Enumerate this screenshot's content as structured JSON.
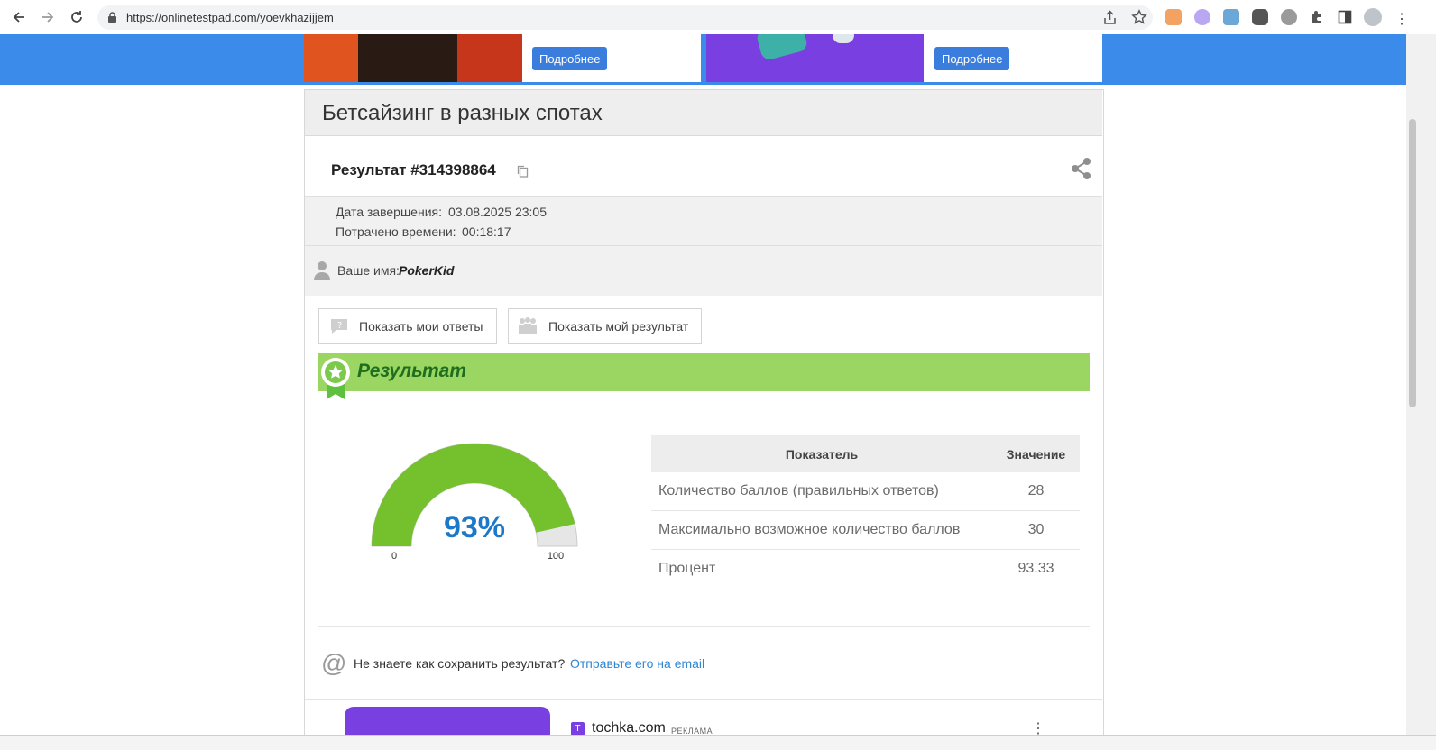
{
  "browser": {
    "url": "https://onlinetestpad.com/yoevkhazijjem"
  },
  "ads": {
    "more_label_1": "Подробнее",
    "more_label_2": "Подробнее"
  },
  "test": {
    "title": "Бетсайзинг в разных спотах",
    "result_label": "Результат #314398864",
    "finished_label": "Дата завершения:",
    "finished_value": "03.08.2025 23:05",
    "spent_label": "Потрачено времени:",
    "spent_value": "00:18:17",
    "name_label": "Ваше имя:",
    "name_value": "PokerKid",
    "show_answers": "Показать мои ответы",
    "show_result": "Показать мой результат",
    "section_title": "Результат"
  },
  "gauge": {
    "percent_text": "93%",
    "value": 93,
    "min_label": "0",
    "max_label": "100"
  },
  "table": {
    "head": [
      "Показатель",
      "Значение"
    ],
    "rows": [
      [
        "Количество баллов (правильных ответов)",
        "28"
      ],
      [
        "Максимально возможное количество баллов",
        "30"
      ],
      [
        "Процент",
        "93.33"
      ]
    ]
  },
  "save": {
    "question": "Не знаете как сохранить результат?",
    "link": "Отправьте его на email"
  },
  "footer_ad": {
    "brand": "tochka.com",
    "badge": "РЕКЛАМА"
  },
  "colors": {
    "accent_blue": "#3b8beb",
    "gauge_green": "#74c12d",
    "percent_blue": "#1e78c8",
    "result_green_bar": "#9cd662"
  }
}
